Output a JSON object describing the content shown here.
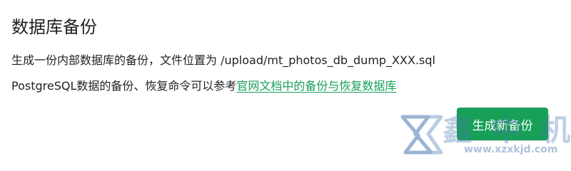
{
  "section": {
    "title": "数据库备份",
    "description_prefix": "生成一份内部数据库的备份，文件位置为 /upload/mt_photos_db_dump_XXX.sql",
    "reference_prefix": "PostgreSQL数据的备份、恢复命令可以参考",
    "reference_link": "官网文档中的备份与恢复数据库",
    "create_button_label": "生成新备份"
  },
  "watermark": {
    "text": "鑫 中 机 电",
    "url": "www.xzxkjd.com"
  },
  "colors": {
    "accent": "#18a058",
    "watermark": "#4b78b3"
  }
}
